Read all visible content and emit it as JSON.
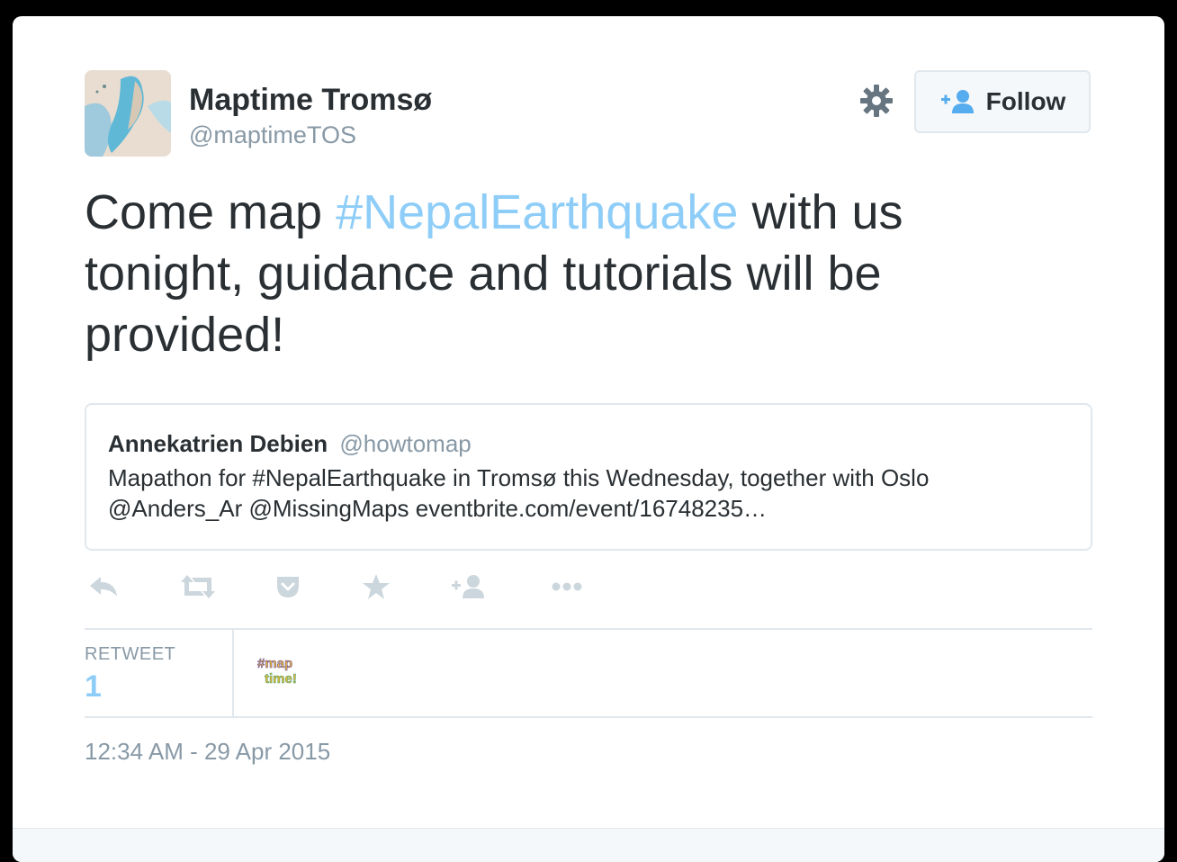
{
  "author": {
    "display_name": "Maptime Tromsø",
    "screen_name": "@maptimeTOS",
    "avatar": "map-avatar"
  },
  "follow_button": {
    "label": "Follow",
    "icon": "add-user-icon"
  },
  "settings_icon": "gear-icon",
  "tweet": {
    "text_before": "Come map ",
    "hashtag": "#NepalEarthquake",
    "text_after": " with us tonight, guidance and tutorials will be provided!"
  },
  "quoted_tweet": {
    "name": "Annekatrien Debien",
    "handle": "@howtomap",
    "text": "Mapathon for #NepalEarthquake in Tromsø this Wednesday, together with Oslo @Anders_Ar @MissingMaps eventbrite.com/event/16748235…"
  },
  "actions": [
    "reply-icon",
    "retweet-icon",
    "pocket-icon",
    "favorite-icon",
    "follow-icon",
    "more-icon"
  ],
  "stats": {
    "retweet_label": "RETWEET",
    "retweet_count": "1",
    "retweeter_avatar": "#map time!"
  },
  "timestamp": "12:34 AM - 29 Apr 2015",
  "colors": {
    "text": "#292f33",
    "muted": "#8899a6",
    "link": "#8ecdf8",
    "border": "#e1e8ed",
    "icon": "#ccd6dd"
  }
}
